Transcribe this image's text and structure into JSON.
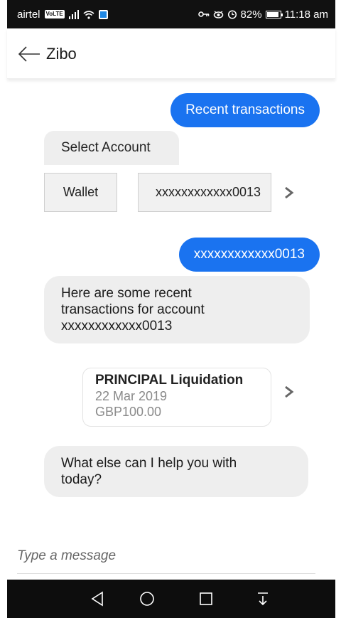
{
  "status_bar": {
    "carrier": "airtel",
    "volte": "VoLTE",
    "battery": "82%",
    "time": "11:18 am"
  },
  "header": {
    "title": "Zibo"
  },
  "chat": {
    "user_message_1": "Recent transactions",
    "select_account_label": "Select Account",
    "account_options": [
      "Wallet",
      "xxxxxxxxxxxx0013"
    ],
    "user_message_2": "xxxxxxxxxxxx0013",
    "bot_message_1_line1": "Here are some recent",
    "bot_message_1_line2": "transactions for account",
    "bot_message_1_line3": "xxxxxxxxxxxx0013",
    "transaction_card": {
      "title": "PRINCIPAL Liquidation",
      "date": "22 Mar 2019",
      "amount": "GBP100.00"
    },
    "bot_message_2_line1": "What else can I help you with",
    "bot_message_2_line2": "today?"
  },
  "composer": {
    "placeholder": "Type a message"
  },
  "colors": {
    "accent": "#1a73f0",
    "bot_bubble": "#eeeeee",
    "status_bar": "#111111"
  },
  "icons": {
    "back": "arrow-left-icon",
    "chevron": "chevron-right-icon",
    "nav_back": "triangle-back-icon",
    "nav_home": "circle-home-icon",
    "nav_recent": "square-recents-icon",
    "nav_notifications": "pull-down-icon"
  }
}
